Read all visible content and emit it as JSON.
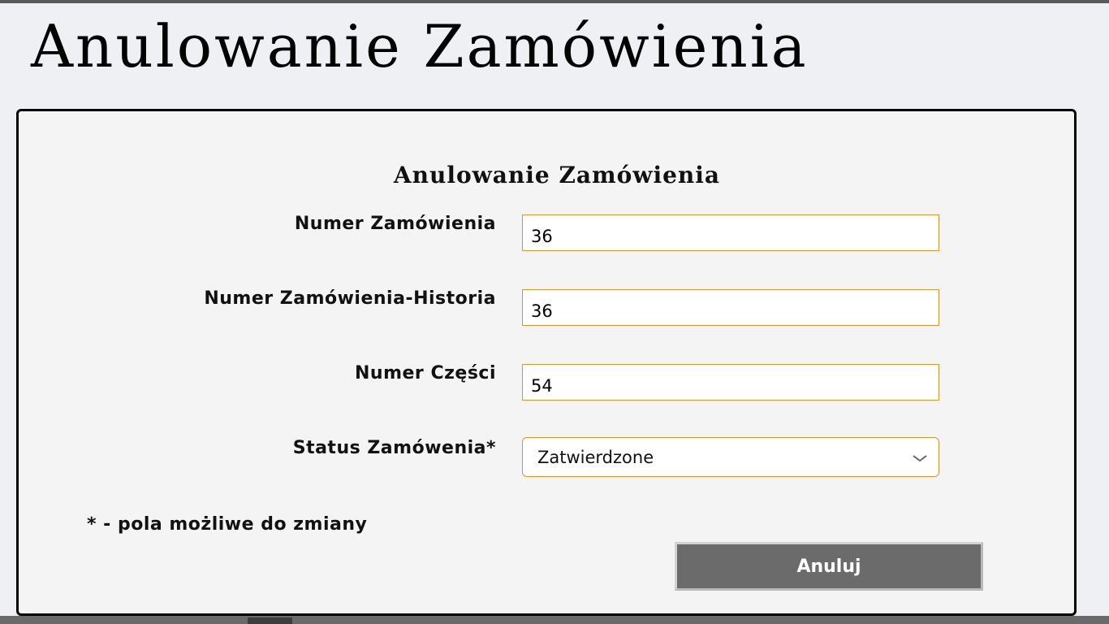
{
  "page": {
    "title": "Anulowanie Zamówienia"
  },
  "form": {
    "title": "Anulowanie Zamówienia",
    "fields": [
      {
        "label": "Numer Zamówienia",
        "value": "36"
      },
      {
        "label": "Numer Zamówienia-Historia",
        "value": "36"
      },
      {
        "label": "Numer Części",
        "value": "54"
      }
    ],
    "status": {
      "label": "Status Zamówenia*",
      "selected": "Zatwierdzone",
      "icon": "chevron-down-icon"
    },
    "required_note": "* - pola możliwe do zmiany",
    "cancel_label": "Anuluj"
  },
  "colors": {
    "background": "#eef0f4",
    "panel": "#f4f4f4",
    "input_border": "#d9962c",
    "button": "#6b6b6b"
  }
}
